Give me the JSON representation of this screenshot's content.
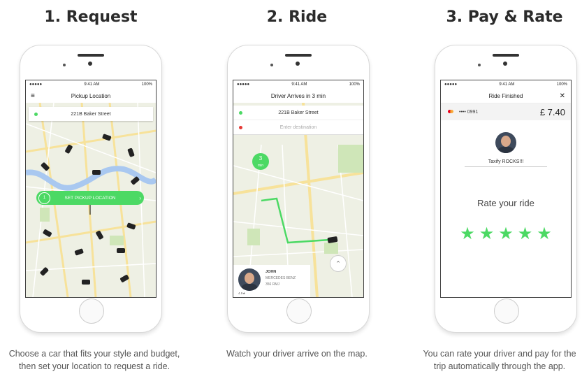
{
  "steps": [
    {
      "title": "1. Request",
      "caption": "Choose a car that fits your style and budget, then set your location to request a ride."
    },
    {
      "title": "2. Ride",
      "caption": "Watch your driver arrive on the map."
    },
    {
      "title": "3. Pay & Rate",
      "caption": "You can rate your driver and pay for the trip automatically through the app."
    }
  ],
  "status": {
    "carrier": "●●●●●",
    "time": "9:41 AM",
    "battery": "100%"
  },
  "phone1": {
    "nav_title": "Pickup Location",
    "menu_icon": "≡",
    "address": "221B Baker Street",
    "pickup_button": "SET PICKUP LOCATION",
    "pickup_eta": "1",
    "pickup_eta_unit": "min"
  },
  "phone2": {
    "nav_title": "Driver Arrives in 3 min",
    "address": "221B Baker Street",
    "destination_placeholder": "Enter destination",
    "eta_number": "3",
    "eta_unit": "min",
    "driver_name": "JOHN",
    "car_model": "MERCEDES BENZ",
    "plate": "356 RMJ",
    "rating": "4.9★"
  },
  "phone3": {
    "nav_title": "Ride Finished",
    "close_icon": "✕",
    "card_number": "•••• 0991",
    "amount": "£ 7.40",
    "comment": "Taxify ROCKS!!!",
    "rate_text": "Rate your ride",
    "stars": 5
  },
  "colors": {
    "accent": "#4cd964",
    "map_bg": "#eef0e4",
    "water": "#a9c8f0"
  }
}
